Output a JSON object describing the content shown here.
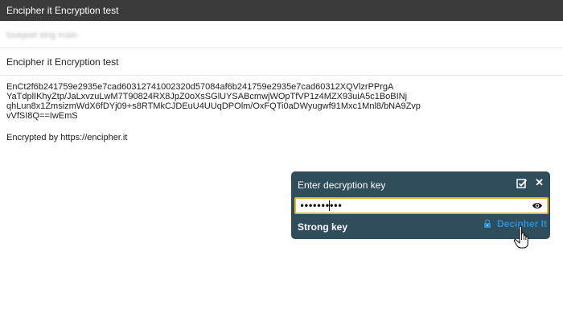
{
  "window": {
    "title": "Encipher it Encryption test"
  },
  "email": {
    "from": "lovejeet sing main",
    "subject": "Encipher it Encryption test",
    "ciphertext_lines": [
      "EnCt2f6b241759e2935e7cad60312741002320d57084af6b241759e2935e7cad60312XQVlzrPPrgA",
      "YaTdplIKhyZtp/JaLxvzuLwM7T90824RX8JpZ0oXsSGlUYSABcmwjWOpTfVP1z4MZX93uiA5c1BoBINj",
      "qhLun8x1ZmsizmWdX6fDYj09+s8RTMkCJDEuU4UUqDPOlm/OxFQTi0aDWyugwf91Mxc1Mnl8/bNA9Zvp",
      "vVfSI8Q==IwEmS"
    ],
    "signature": "Encrypted by https://encipher.it"
  },
  "popup": {
    "title": "Enter decryption key",
    "key_value": "••••••••••",
    "strength_label": "Strong key",
    "decipher_label": "Decipher It",
    "icons": [
      "checkbox-icon",
      "close-icon",
      "eye-icon",
      "lock-icon",
      "hand-cursor-icon"
    ]
  },
  "colors": {
    "titlebar": "#3b3b3b",
    "popup_bg": "#2f4d5b",
    "input_border": "#e8b52a",
    "link": "#2a8fd6"
  }
}
